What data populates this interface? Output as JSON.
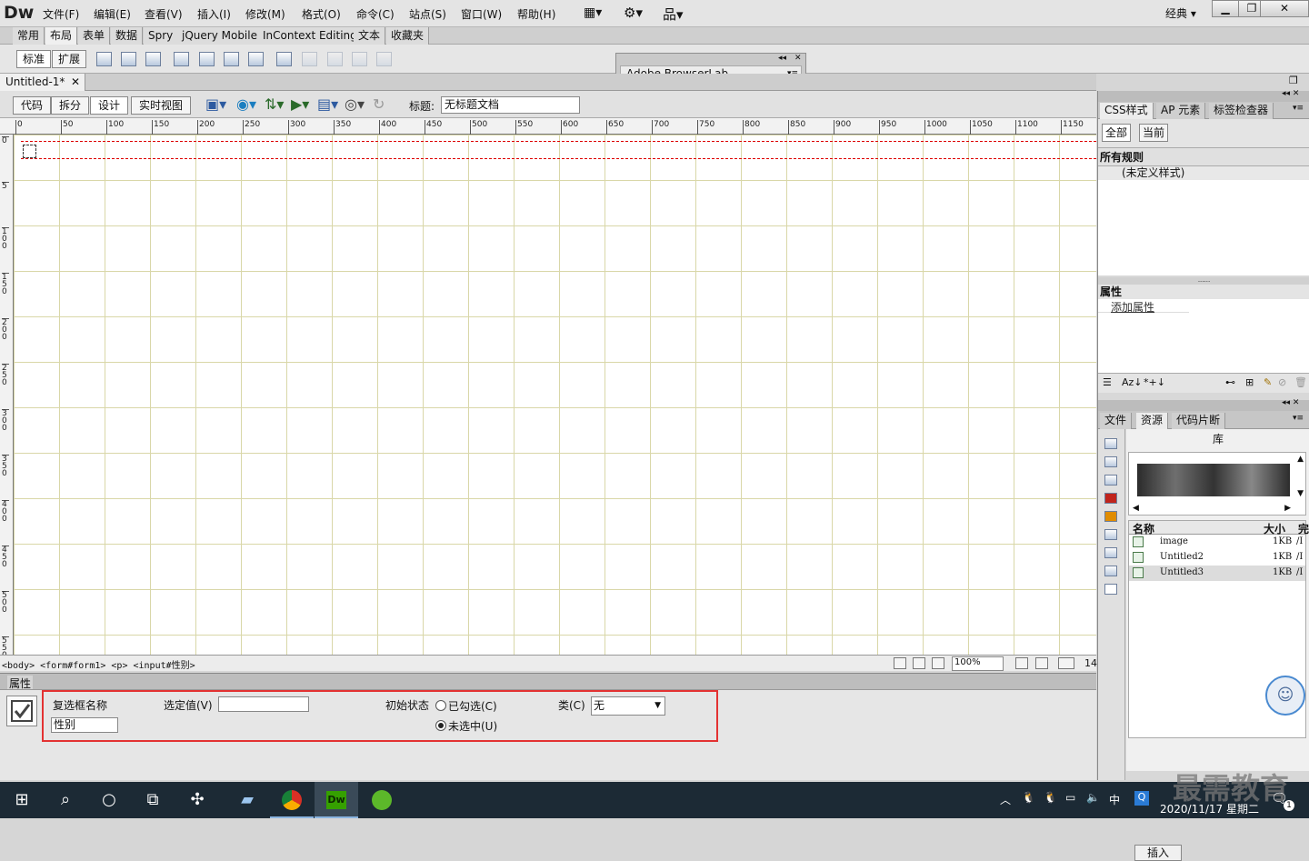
{
  "app": {
    "logo": "Dw",
    "workspace": "经典",
    "win_min": "▁",
    "win_max": "❐",
    "win_close": "✕"
  },
  "menu": [
    "文件(F)",
    "编辑(E)",
    "查看(V)",
    "插入(I)",
    "修改(M)",
    "格式(O)",
    "命令(C)",
    "站点(S)",
    "窗口(W)",
    "帮助(H)"
  ],
  "insert_tabs": [
    "常用",
    "布局",
    "表单",
    "数据",
    "Spry",
    "jQuery Mobile",
    "InContext Editing",
    "文本",
    "收藏夹"
  ],
  "insert_modes": [
    "标准",
    "扩展"
  ],
  "browserlab": {
    "title": "Adobe BrowserLab"
  },
  "document": {
    "tab": "Untitled-1*",
    "views": [
      "代码",
      "拆分",
      "设计",
      "实时视图"
    ],
    "title_label": "标题:",
    "title_value": "无标题文档",
    "ruler_h": [
      "0",
      "50",
      "100",
      "150",
      "200",
      "250",
      "300",
      "350",
      "400",
      "450",
      "500",
      "550",
      "600",
      "650",
      "700",
      "750",
      "800",
      "850",
      "900",
      "950",
      "1000",
      "1050",
      "1100",
      "1150"
    ],
    "ruler_v": [
      "0",
      "5",
      "1 0 0",
      "1 5 0",
      "2 0 0",
      "2 5 0",
      "3 0 0",
      "3 5 0",
      "4 0 0",
      "4 5 0",
      "5 0 0",
      "5 5 0"
    ],
    "tag_selector": "<body> <form#form1> <p> <input#性别>",
    "zoom": "100%",
    "size_hint": "14"
  },
  "properties": {
    "header": "属性",
    "checkbox_name_label": "复选框名称",
    "checkbox_name_value": "性别",
    "checked_value_label": "选定值(V)",
    "checked_value": "",
    "initial_state_label": "初始状态",
    "option_checked": "已勾选(C)",
    "option_unchecked": "未选中(U)",
    "class_label": "类(C)",
    "class_value": "无"
  },
  "css_panel": {
    "tabs": [
      "CSS样式",
      "AP 元素",
      "标签检查器"
    ],
    "modes": [
      "全部",
      "当前"
    ],
    "all_rules": "所有规则",
    "undefined_style": "(未定义样式)",
    "properties_title": "属性",
    "add_property": "添加属性"
  },
  "files_panel": {
    "tabs": [
      "文件",
      "资源",
      "代码片断"
    ],
    "library_title": "库",
    "col_name": "名称",
    "col_size": "大小",
    "col_more": "完",
    "rows": [
      {
        "name": "image",
        "size": "1KB",
        "path": "/I"
      },
      {
        "name": "Untitled2",
        "size": "1KB",
        "path": "/I"
      },
      {
        "name": "Untitled3",
        "size": "1KB",
        "path": "/I"
      }
    ],
    "insert_button": "插入"
  },
  "taskbar": {
    "ime": "中",
    "date": "2020/11/17 星期二",
    "watermark": "最需教育",
    "notif": "1"
  },
  "colors": {
    "highlight_box": "#e33232",
    "taskbar": "#1c2a35"
  }
}
